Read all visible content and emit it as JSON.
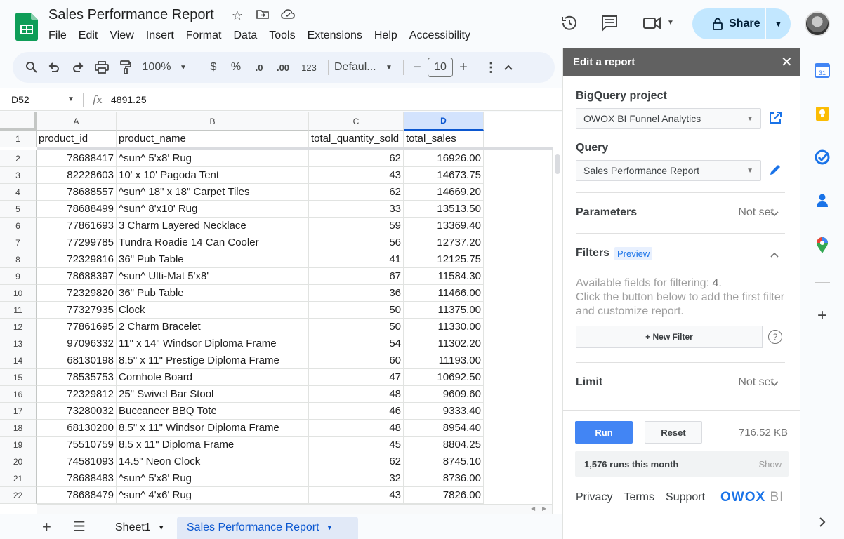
{
  "header": {
    "title": "Sales Performance Report",
    "menu": [
      "File",
      "Edit",
      "View",
      "Insert",
      "Format",
      "Data",
      "Tools",
      "Extensions",
      "Help",
      "Accessibility"
    ],
    "share_label": "Share"
  },
  "toolbar": {
    "zoom": "100%",
    "currency": "$",
    "percent": "%",
    "dec_decrease": ".0",
    "dec_increase": ".00",
    "number_format": "123",
    "font": "Defaul...",
    "font_size": "10"
  },
  "formula_bar": {
    "cell_ref": "D52",
    "fx": "fx",
    "value": "4891.25"
  },
  "grid": {
    "column_letters": [
      "A",
      "B",
      "C",
      "D"
    ],
    "header_row_number": "1",
    "headers": [
      "product_id",
      "product_name",
      "total_quantity_sold",
      "total_sales"
    ],
    "rows": [
      {
        "n": "2",
        "id": "78688417",
        "name": "^sun^ 5'x8' Rug",
        "qty": "62",
        "sales": "16926.00"
      },
      {
        "n": "3",
        "id": "82228603",
        "name": "10' x 10' Pagoda Tent",
        "qty": "43",
        "sales": "14673.75"
      },
      {
        "n": "4",
        "id": "78688557",
        "name": "^sun^ 18\" x 18\" Carpet Tiles",
        "qty": "62",
        "sales": "14669.20"
      },
      {
        "n": "5",
        "id": "78688499",
        "name": "^sun^ 8'x10' Rug",
        "qty": "33",
        "sales": "13513.50"
      },
      {
        "n": "6",
        "id": "77861693",
        "name": "3 Charm Layered Necklace",
        "qty": "59",
        "sales": "13369.40"
      },
      {
        "n": "7",
        "id": "77299785",
        "name": "Tundra Roadie 14 Can Cooler",
        "qty": "56",
        "sales": "12737.20"
      },
      {
        "n": "8",
        "id": "72329816",
        "name": "36\" Pub Table",
        "qty": "41",
        "sales": "12125.75"
      },
      {
        "n": "9",
        "id": "78688397",
        "name": "^sun^ Ulti-Mat 5'x8'",
        "qty": "67",
        "sales": "11584.30"
      },
      {
        "n": "10",
        "id": "72329820",
        "name": "36\" Pub Table",
        "qty": "36",
        "sales": "11466.00"
      },
      {
        "n": "11",
        "id": "77327935",
        "name": "Clock",
        "qty": "50",
        "sales": "11375.00"
      },
      {
        "n": "12",
        "id": "77861695",
        "name": "2 Charm Bracelet",
        "qty": "50",
        "sales": "11330.00"
      },
      {
        "n": "13",
        "id": "97096332",
        "name": "11\" x 14\" Windsor Diploma Frame",
        "qty": "54",
        "sales": "11302.20"
      },
      {
        "n": "14",
        "id": "68130198",
        "name": "8.5\" x 11\" Prestige Diploma Frame",
        "qty": "60",
        "sales": "11193.00"
      },
      {
        "n": "15",
        "id": "78535753",
        "name": "Cornhole Board",
        "qty": "47",
        "sales": "10692.50"
      },
      {
        "n": "16",
        "id": "72329812",
        "name": "25\" Swivel Bar Stool",
        "qty": "48",
        "sales": "9609.60"
      },
      {
        "n": "17",
        "id": "73280032",
        "name": "Buccaneer BBQ Tote",
        "qty": "46",
        "sales": "9333.40"
      },
      {
        "n": "18",
        "id": "68130200",
        "name": "8.5\" x 11\" Windsor Diploma Frame",
        "qty": "48",
        "sales": "8954.40"
      },
      {
        "n": "19",
        "id": "75510759",
        "name": "8.5 x 11\" Diploma Frame",
        "qty": "45",
        "sales": "8804.25"
      },
      {
        "n": "20",
        "id": "74581093",
        "name": "14.5\" Neon Clock",
        "qty": "62",
        "sales": "8745.10"
      },
      {
        "n": "21",
        "id": "78688483",
        "name": "^sun^ 5'x8' Rug",
        "qty": "32",
        "sales": "8736.00"
      },
      {
        "n": "22",
        "id": "78688479",
        "name": "^sun^ 4'x6' Rug",
        "qty": "43",
        "sales": "7826.00"
      }
    ]
  },
  "sheets": {
    "tabs": [
      "Sheet1",
      "Sales Performance Report"
    ],
    "active": "Sales Performance Report"
  },
  "panel": {
    "title": "Edit a report",
    "bigquery_label": "BigQuery project",
    "bigquery_value": "OWOX BI Funnel Analytics",
    "query_label": "Query",
    "query_value": "Sales Performance Report",
    "parameters_label": "Parameters",
    "parameters_value": "Not set",
    "filters_label": "Filters",
    "filters_badge": "Preview",
    "filters_help_prefix": "Available fields for filtering: ",
    "filters_count": "4.",
    "filters_help_rest": "Click the button below to add the first filter and customize report.",
    "new_filter_label": "+ New Filter",
    "help": "?",
    "limit_label": "Limit",
    "limit_value": "Not set",
    "run_label": "Run",
    "reset_label": "Reset",
    "size": "716.52 KB",
    "runs_text": "1,576 runs this month",
    "show_label": "Show",
    "links": [
      "Privacy",
      "Terms",
      "Support"
    ],
    "brand": "OWOX",
    "brand_suffix": "BI"
  },
  "rail": {
    "calendar_day": "31"
  },
  "colors": {
    "share_bg": "#c2e7ff",
    "selected_col": "#d3e3fd",
    "run_button": "#4285f4",
    "panel_header": "#616161",
    "sheets_green": "#0f9d58"
  }
}
